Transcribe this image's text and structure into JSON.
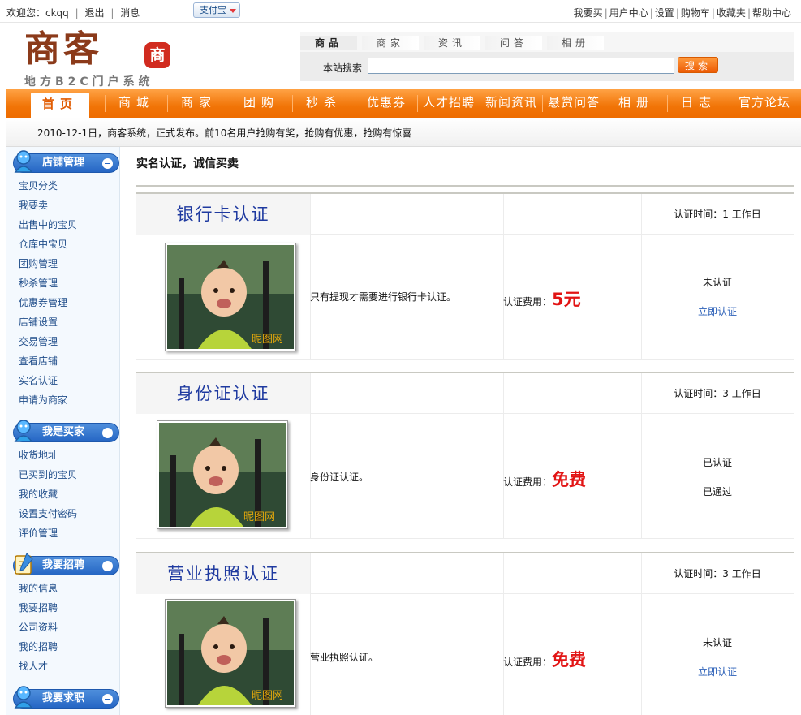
{
  "topbar": {
    "welcome": "欢迎您：ckqq",
    "logout": "退出",
    "messages": "消息",
    "alipay": "支付宝",
    "links": [
      "我要买",
      "用户中心",
      "设置",
      "购物车",
      "收藏夹",
      "帮助中心"
    ]
  },
  "logo": {
    "main": "商客",
    "stamp": "商",
    "sub": "地方B2C门户系统"
  },
  "search": {
    "tabs": [
      "商品",
      "商家",
      "资讯",
      "问答",
      "相册"
    ],
    "label": "本站搜索",
    "value": "",
    "button": "搜索"
  },
  "nav": [
    "首页",
    "商城",
    "商家",
    "团购",
    "秒杀",
    "优惠券",
    "人才招聘",
    "新闻资讯",
    "悬赏问答",
    "相册",
    "日志",
    "官方论坛"
  ],
  "notice": "2010-12-1日，商客系统，正式发布。前10名用户抢购有奖，抢购有优惠，抢购有惊喜",
  "sidebar": [
    {
      "title": "店铺管理",
      "icon": "user-icon",
      "items": [
        "宝贝分类",
        "我要卖",
        "出售中的宝贝",
        "仓库中宝贝",
        "团购管理",
        "秒杀管理",
        "优惠券管理",
        "店铺设置",
        "交易管理",
        "查看店铺",
        "实名认证",
        "申请为商家"
      ]
    },
    {
      "title": "我是买家",
      "icon": "user-icon",
      "items": [
        "收货地址",
        "已买到的宝贝",
        "我的收藏",
        "设置支付密码",
        "评价管理"
      ]
    },
    {
      "title": "我要招聘",
      "icon": "notepad-icon",
      "items": [
        "我的信息",
        "我要招聘",
        "公司资料",
        "我的招聘",
        "找人才"
      ]
    },
    {
      "title": "我要求职",
      "icon": "user-icon",
      "items": []
    }
  ],
  "content": {
    "title": "实名认证，诚信买卖",
    "fee_label": "认证费用：",
    "watermark": "昵图网",
    "certs": [
      {
        "name": "银行卡认证",
        "time": "认证时间：1 工作日",
        "desc": "只有提现才需要进行银行卡认证。",
        "fee": "5元",
        "fee_num": "5",
        "fee_unit": "元",
        "status": "未认证",
        "action": "立即认证"
      },
      {
        "name": "身份证认证",
        "time": "认证时间：3 工作日",
        "desc": "身份证认证。",
        "fee": "免费",
        "fee_num": "",
        "fee_unit": "免费",
        "status": "已认证",
        "action": "已通过"
      },
      {
        "name": "营业执照认证",
        "time": "认证时间：3 工作日",
        "desc": "营业执照认证。",
        "fee": "免费",
        "fee_num": "",
        "fee_unit": "免费",
        "status": "未认证",
        "action": "立即认证"
      }
    ]
  }
}
